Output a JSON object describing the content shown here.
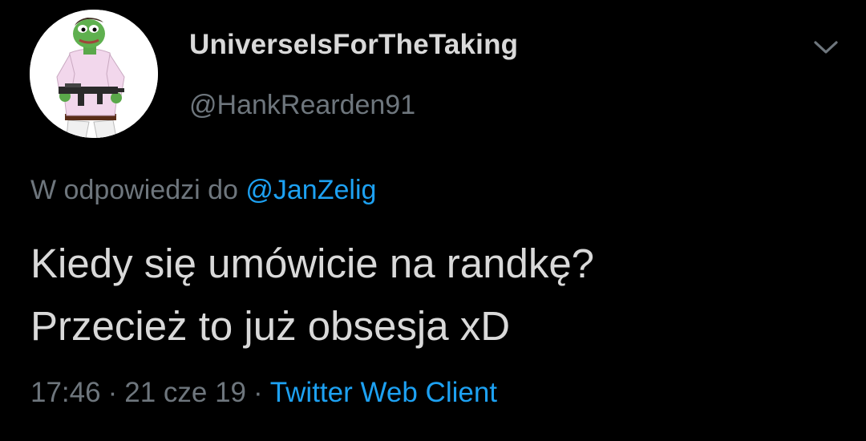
{
  "user": {
    "display_name": "UniverseIsForTheTaking",
    "handle": "@HankRearden91",
    "avatar_icon": "avatar-illustration"
  },
  "menu": {
    "icon": "chevron-down-icon"
  },
  "reply": {
    "prefix": "W odpowiedzi do",
    "mention": "@JanZelig"
  },
  "tweet": {
    "lines": [
      "Kiedy się umówicie na randkę?",
      "Przecież to już obsesja xD"
    ]
  },
  "meta": {
    "time": "17:46",
    "separator": "·",
    "date": "21 cze 19",
    "source": "Twitter Web Client"
  },
  "colors": {
    "background": "#000000",
    "text": "#d9d9d9",
    "secondary": "#6e767d",
    "accent": "#1da1f2"
  }
}
